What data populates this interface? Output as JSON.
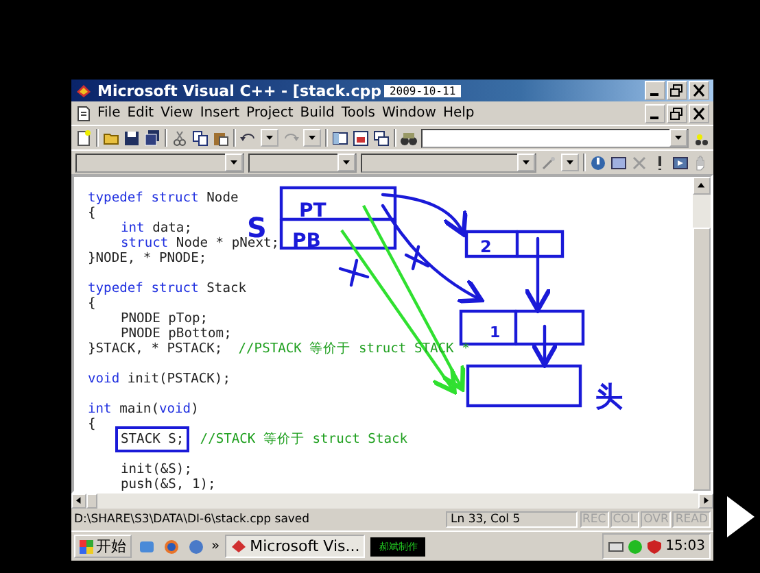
{
  "overlay_date": "2009-10-11",
  "window": {
    "title": "Microsoft Visual C++ - [stack.cpp"
  },
  "menu": [
    "File",
    "Edit",
    "View",
    "Insert",
    "Project",
    "Build",
    "Tools",
    "Window",
    "Help"
  ],
  "editor": {
    "lines": [
      {
        "indented": false,
        "blank_before": false,
        "segments": [
          {
            "kind": "keyword",
            "text": "typedef struct"
          },
          {
            "kind": "plain",
            "text": " Node"
          }
        ]
      },
      {
        "indented": false,
        "blank_before": false,
        "segments": [
          {
            "kind": "plain",
            "text": "{"
          }
        ]
      },
      {
        "indented": true,
        "blank_before": false,
        "segments": [
          {
            "kind": "keyword",
            "text": "int"
          },
          {
            "kind": "plain",
            "text": " data;"
          }
        ]
      },
      {
        "indented": true,
        "blank_before": false,
        "segments": [
          {
            "kind": "keyword",
            "text": "struct"
          },
          {
            "kind": "plain",
            "text": " Node * pNext;"
          }
        ]
      },
      {
        "indented": false,
        "blank_before": false,
        "segments": [
          {
            "kind": "plain",
            "text": "}NODE, * PNODE;"
          }
        ]
      },
      {
        "indented": false,
        "blank_before": true,
        "segments": [
          {
            "kind": "keyword",
            "text": "typedef struct"
          },
          {
            "kind": "plain",
            "text": " Stack"
          }
        ]
      },
      {
        "indented": false,
        "blank_before": false,
        "segments": [
          {
            "kind": "plain",
            "text": "{"
          }
        ]
      },
      {
        "indented": true,
        "blank_before": false,
        "segments": [
          {
            "kind": "plain",
            "text": "PNODE pTop;"
          }
        ]
      },
      {
        "indented": true,
        "blank_before": false,
        "segments": [
          {
            "kind": "plain",
            "text": "PNODE pBottom;"
          }
        ]
      },
      {
        "indented": false,
        "blank_before": false,
        "segments": [
          {
            "kind": "plain",
            "text": "}STACK, * PSTACK;"
          },
          {
            "kind": "comment",
            "text": "  //PSTACK 等价于 struct STACK *"
          }
        ]
      },
      {
        "indented": false,
        "blank_before": true,
        "segments": [
          {
            "kind": "keyword",
            "text": "void"
          },
          {
            "kind": "plain",
            "text": " init(PSTACK);"
          }
        ]
      },
      {
        "indented": false,
        "blank_before": true,
        "segments": [
          {
            "kind": "keyword",
            "text": "int"
          },
          {
            "kind": "plain",
            "text": " main("
          },
          {
            "kind": "keyword",
            "text": "void"
          },
          {
            "kind": "plain",
            "text": ")"
          }
        ]
      },
      {
        "indented": false,
        "blank_before": false,
        "segments": [
          {
            "kind": "plain",
            "text": "{"
          }
        ]
      },
      {
        "indented": true,
        "blank_before": false,
        "segments": [
          {
            "kind": "plain",
            "text": "STACK S;",
            "circled": true
          },
          {
            "kind": "comment",
            "text": "  //STACK 等价于 struct Stack",
            "circled": false
          }
        ]
      },
      {
        "indented": true,
        "blank_before": true,
        "segments": [
          {
            "kind": "plain",
            "text": "init(&S);"
          }
        ]
      },
      {
        "indented": true,
        "blank_before": false,
        "segments": [
          {
            "kind": "plain",
            "text": "push(&S, 1);"
          }
        ]
      }
    ]
  },
  "sketch": {
    "labels": [
      "S",
      "PT",
      "PB",
      "2",
      "1",
      "头"
    ]
  },
  "status_bar": {
    "message": "D:\\SHARE\\S3\\DATA\\DI-6\\stack.cpp saved",
    "position": "Ln 33, Col 5",
    "indicators": [
      {
        "text": "REC",
        "disabled": true
      },
      {
        "text": "COL",
        "disabled": true
      },
      {
        "text": "OVR",
        "disabled": true
      },
      {
        "text": "READ",
        "disabled": true
      }
    ]
  },
  "taskbar": {
    "start": "开始",
    "overflow": "»",
    "task": "Microsoft Vis...",
    "credit": "郝斌制作",
    "clock": "15:03"
  }
}
